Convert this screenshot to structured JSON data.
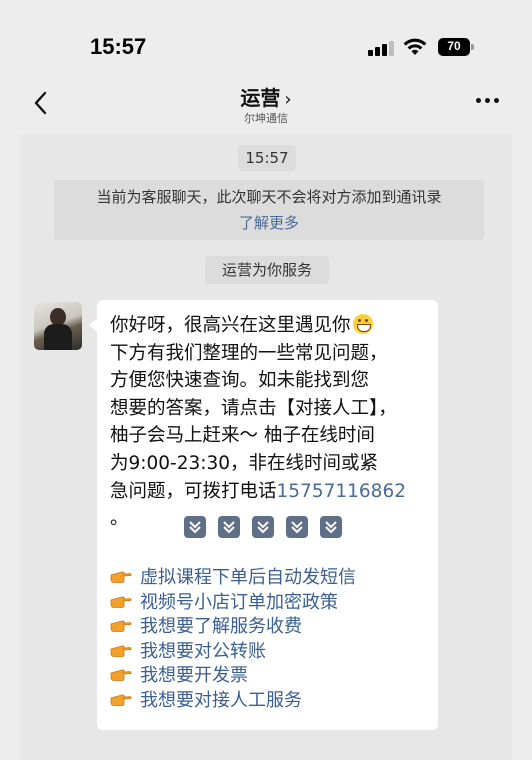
{
  "status_bar": {
    "time": "15:57",
    "battery": "70"
  },
  "nav": {
    "title": "运营",
    "chevron": "›",
    "subtitle": "尔坤通信"
  },
  "chat": {
    "timestamp": "15:57",
    "notice": "当前为客服聊天，此次聊天不会将对方添加到通讯录",
    "notice_link": "了解更多",
    "service_label": "运营为你服务",
    "message": {
      "line1": "你好呀，很高兴在这里遇见你",
      "line2": "下方有我们整理的一些常见问题，",
      "line3": "方便您快速查询。如未能找到您",
      "line4": "想要的答案，请点击【对接人工】，",
      "line5": "柚子会马上赶来～  柚子在线时间",
      "line6": "为9:00-23:30，非在线时间或紧",
      "line7": "急问题，可拨打电话",
      "phone": "15757116862",
      "line8": "。"
    },
    "faq": [
      {
        "label": "虚拟课程下单后自动发短信"
      },
      {
        "label": "视频号小店订单加密政策"
      },
      {
        "label": "我想要了解服务收费"
      },
      {
        "label": "我想要对公转账"
      },
      {
        "label": "我想要开发票"
      },
      {
        "label": "我想要对接人工服务"
      }
    ]
  },
  "colors": {
    "background": "#ededed",
    "bubble": "#ffffff",
    "link": "#4a6b96",
    "arrow_box": "#5f6f87",
    "hand": "#f4a12c"
  },
  "icons": [
    "back-chevron-icon",
    "more-dots-icon",
    "signal-icon",
    "wifi-icon",
    "battery-icon",
    "grin-emoji-icon",
    "down-arrow-icon",
    "pointing-hand-icon"
  ]
}
